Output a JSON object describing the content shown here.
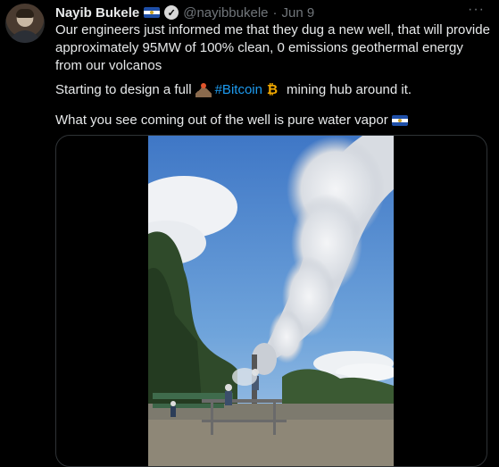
{
  "author": {
    "name": "Nayib Bukele",
    "handle": "@nayibbukele",
    "separator": "·",
    "date": "Jun 9",
    "verified_icon": "check-badge-icon",
    "flag_icon": "el-salvador-flag-icon"
  },
  "menu": {
    "more_label": "···"
  },
  "tweet": {
    "paragraph1": "Our engineers just informed me that they dug a new well, that will provide approximately 95MW of 100% clean, 0 emissions geothermal energy from our volcanos",
    "paragraph2_prefix": "Starting to design a full",
    "paragraph2_hashtag": "#Bitcoin",
    "paragraph2_suffix": "mining hub around it.",
    "paragraph3": "What you see coming out of the well is pure water vapor"
  },
  "colors": {
    "background": "#000000",
    "text": "#e7e9ea",
    "muted": "#71767b",
    "link": "#1d9bf0",
    "border": "#2f3336"
  }
}
